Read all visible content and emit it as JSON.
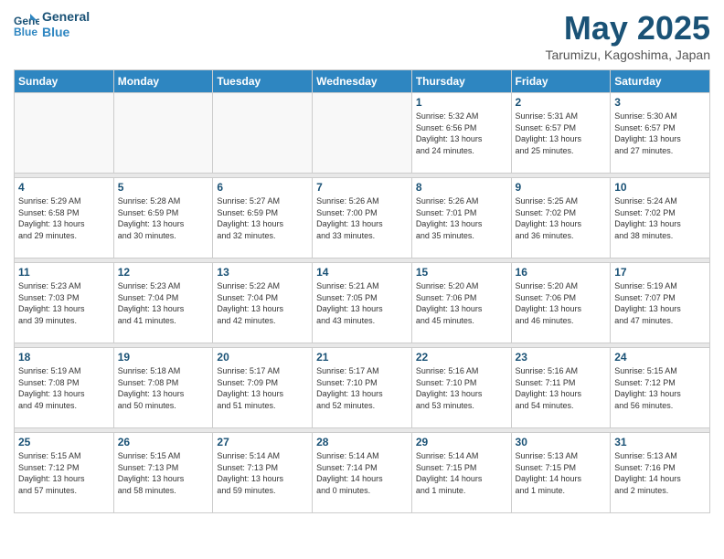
{
  "header": {
    "logo_line1": "General",
    "logo_line2": "Blue",
    "title": "May 2025",
    "subtitle": "Tarumizu, Kagoshima, Japan"
  },
  "weekdays": [
    "Sunday",
    "Monday",
    "Tuesday",
    "Wednesday",
    "Thursday",
    "Friday",
    "Saturday"
  ],
  "weeks": [
    [
      {
        "day": "",
        "info": ""
      },
      {
        "day": "",
        "info": ""
      },
      {
        "day": "",
        "info": ""
      },
      {
        "day": "",
        "info": ""
      },
      {
        "day": "1",
        "info": "Sunrise: 5:32 AM\nSunset: 6:56 PM\nDaylight: 13 hours\nand 24 minutes."
      },
      {
        "day": "2",
        "info": "Sunrise: 5:31 AM\nSunset: 6:57 PM\nDaylight: 13 hours\nand 25 minutes."
      },
      {
        "day": "3",
        "info": "Sunrise: 5:30 AM\nSunset: 6:57 PM\nDaylight: 13 hours\nand 27 minutes."
      }
    ],
    [
      {
        "day": "4",
        "info": "Sunrise: 5:29 AM\nSunset: 6:58 PM\nDaylight: 13 hours\nand 29 minutes."
      },
      {
        "day": "5",
        "info": "Sunrise: 5:28 AM\nSunset: 6:59 PM\nDaylight: 13 hours\nand 30 minutes."
      },
      {
        "day": "6",
        "info": "Sunrise: 5:27 AM\nSunset: 6:59 PM\nDaylight: 13 hours\nand 32 minutes."
      },
      {
        "day": "7",
        "info": "Sunrise: 5:26 AM\nSunset: 7:00 PM\nDaylight: 13 hours\nand 33 minutes."
      },
      {
        "day": "8",
        "info": "Sunrise: 5:26 AM\nSunset: 7:01 PM\nDaylight: 13 hours\nand 35 minutes."
      },
      {
        "day": "9",
        "info": "Sunrise: 5:25 AM\nSunset: 7:02 PM\nDaylight: 13 hours\nand 36 minutes."
      },
      {
        "day": "10",
        "info": "Sunrise: 5:24 AM\nSunset: 7:02 PM\nDaylight: 13 hours\nand 38 minutes."
      }
    ],
    [
      {
        "day": "11",
        "info": "Sunrise: 5:23 AM\nSunset: 7:03 PM\nDaylight: 13 hours\nand 39 minutes."
      },
      {
        "day": "12",
        "info": "Sunrise: 5:23 AM\nSunset: 7:04 PM\nDaylight: 13 hours\nand 41 minutes."
      },
      {
        "day": "13",
        "info": "Sunrise: 5:22 AM\nSunset: 7:04 PM\nDaylight: 13 hours\nand 42 minutes."
      },
      {
        "day": "14",
        "info": "Sunrise: 5:21 AM\nSunset: 7:05 PM\nDaylight: 13 hours\nand 43 minutes."
      },
      {
        "day": "15",
        "info": "Sunrise: 5:20 AM\nSunset: 7:06 PM\nDaylight: 13 hours\nand 45 minutes."
      },
      {
        "day": "16",
        "info": "Sunrise: 5:20 AM\nSunset: 7:06 PM\nDaylight: 13 hours\nand 46 minutes."
      },
      {
        "day": "17",
        "info": "Sunrise: 5:19 AM\nSunset: 7:07 PM\nDaylight: 13 hours\nand 47 minutes."
      }
    ],
    [
      {
        "day": "18",
        "info": "Sunrise: 5:19 AM\nSunset: 7:08 PM\nDaylight: 13 hours\nand 49 minutes."
      },
      {
        "day": "19",
        "info": "Sunrise: 5:18 AM\nSunset: 7:08 PM\nDaylight: 13 hours\nand 50 minutes."
      },
      {
        "day": "20",
        "info": "Sunrise: 5:17 AM\nSunset: 7:09 PM\nDaylight: 13 hours\nand 51 minutes."
      },
      {
        "day": "21",
        "info": "Sunrise: 5:17 AM\nSunset: 7:10 PM\nDaylight: 13 hours\nand 52 minutes."
      },
      {
        "day": "22",
        "info": "Sunrise: 5:16 AM\nSunset: 7:10 PM\nDaylight: 13 hours\nand 53 minutes."
      },
      {
        "day": "23",
        "info": "Sunrise: 5:16 AM\nSunset: 7:11 PM\nDaylight: 13 hours\nand 54 minutes."
      },
      {
        "day": "24",
        "info": "Sunrise: 5:15 AM\nSunset: 7:12 PM\nDaylight: 13 hours\nand 56 minutes."
      }
    ],
    [
      {
        "day": "25",
        "info": "Sunrise: 5:15 AM\nSunset: 7:12 PM\nDaylight: 13 hours\nand 57 minutes."
      },
      {
        "day": "26",
        "info": "Sunrise: 5:15 AM\nSunset: 7:13 PM\nDaylight: 13 hours\nand 58 minutes."
      },
      {
        "day": "27",
        "info": "Sunrise: 5:14 AM\nSunset: 7:13 PM\nDaylight: 13 hours\nand 59 minutes."
      },
      {
        "day": "28",
        "info": "Sunrise: 5:14 AM\nSunset: 7:14 PM\nDaylight: 14 hours\nand 0 minutes."
      },
      {
        "day": "29",
        "info": "Sunrise: 5:14 AM\nSunset: 7:15 PM\nDaylight: 14 hours\nand 1 minute."
      },
      {
        "day": "30",
        "info": "Sunrise: 5:13 AM\nSunset: 7:15 PM\nDaylight: 14 hours\nand 1 minute."
      },
      {
        "day": "31",
        "info": "Sunrise: 5:13 AM\nSunset: 7:16 PM\nDaylight: 14 hours\nand 2 minutes."
      }
    ]
  ]
}
